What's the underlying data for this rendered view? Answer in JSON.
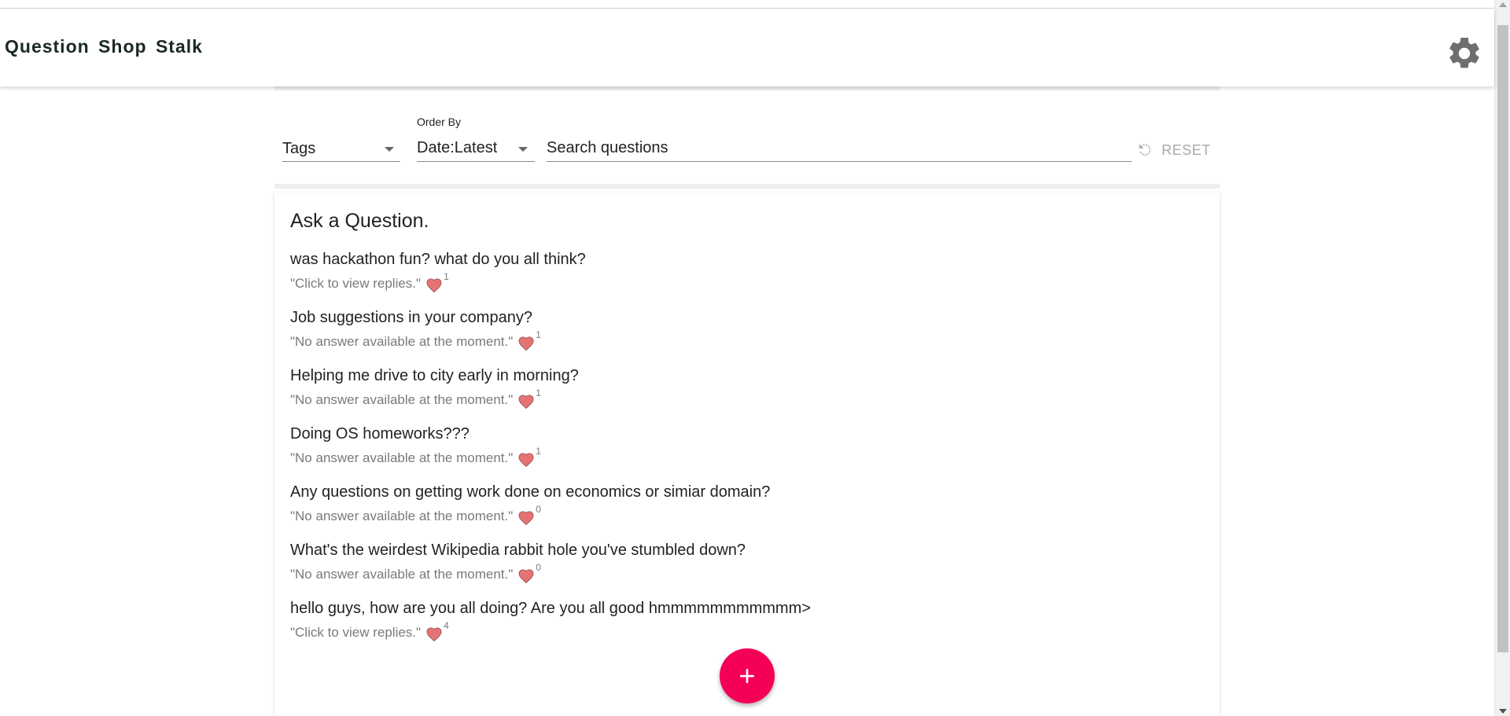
{
  "app": {
    "title": "Question Shop Stalk"
  },
  "filters": {
    "tags_value": "Tags",
    "order_label": "Order By",
    "order_value": "Date:Latest",
    "search_placeholder": "Search questions",
    "reset_label": "RESET"
  },
  "card": {
    "title": "Ask a Question."
  },
  "questions": [
    {
      "text": "was hackathon fun? what do you all think?",
      "subtitle": "\"Click to view replies.\"",
      "likes": "1"
    },
    {
      "text": "Job suggestions in your company?",
      "subtitle": "\"No answer available at the moment.\"",
      "likes": "1"
    },
    {
      "text": "Helping me drive to city early in morning?",
      "subtitle": "\"No answer available at the moment.\"",
      "likes": "1"
    },
    {
      "text": "Doing OS homeworks???",
      "subtitle": "\"No answer available at the moment.\"",
      "likes": "1"
    },
    {
      "text": "Any questions on getting work done on economics or simiar domain?",
      "subtitle": "\"No answer available at the moment.\"",
      "likes": "0"
    },
    {
      "text": "What's the weirdest Wikipedia rabbit hole you've stumbled down?",
      "subtitle": "\"No answer available at the moment.\"",
      "likes": "0"
    },
    {
      "text": "hello guys, how are you all doing? Are you all good hmmmmmmmmmmm>",
      "subtitle": "\"Click to view replies.\"",
      "likes": "4"
    }
  ],
  "fab": {
    "label": "+"
  },
  "icons": {
    "settings": "gear-icon",
    "reset": "refresh-icon",
    "like": "heart-icon",
    "dropdown": "chevron-down-icon",
    "add": "plus-icon"
  },
  "colors": {
    "accent": "#f50057",
    "heart": "#e57373",
    "reset_text": "#a9a9a9"
  }
}
